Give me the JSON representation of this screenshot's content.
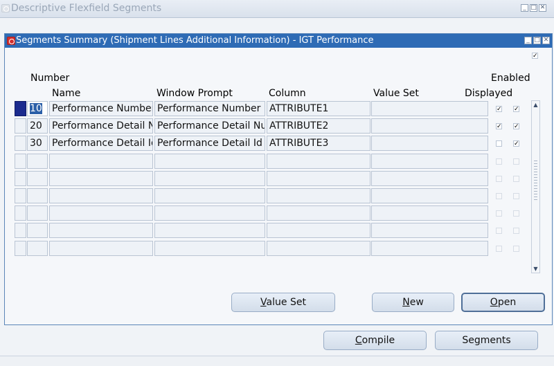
{
  "outer_window": {
    "title": "Descriptive Flexfield Segments",
    "controls": [
      "_",
      "□",
      "✕"
    ]
  },
  "inner_window": {
    "title": "Segments Summary (Shipment Lines Additional Information) - IGT Performance",
    "controls": [
      "_",
      "□",
      "✕"
    ],
    "top_checkbox": "✓"
  },
  "headers": {
    "number": "Number",
    "name": "Name",
    "window_prompt": "Window Prompt",
    "column": "Column",
    "value_set": "Value Set",
    "enabled": "Enabled",
    "displayed": "Displayed"
  },
  "rows": [
    {
      "number": "10",
      "name": "Performance Number",
      "window_prompt": "Performance Number",
      "column": "ATTRIBUTE1",
      "value_set": "",
      "displayed": "✓",
      "enabled": "✓"
    },
    {
      "number": "20",
      "name": "Performance Detail Nu",
      "window_prompt": "Performance Detail Nur",
      "column": "ATTRIBUTE2",
      "value_set": "",
      "displayed": "✓",
      "enabled": "✓"
    },
    {
      "number": "30",
      "name": "Performance Detail Id",
      "window_prompt": "Performance Detail Id",
      "column": "ATTRIBUTE3",
      "value_set": "",
      "displayed": "",
      "enabled": "✓"
    },
    {
      "number": "",
      "name": "",
      "window_prompt": "",
      "column": "",
      "value_set": "",
      "displayed": "",
      "enabled": ""
    },
    {
      "number": "",
      "name": "",
      "window_prompt": "",
      "column": "",
      "value_set": "",
      "displayed": "",
      "enabled": ""
    },
    {
      "number": "",
      "name": "",
      "window_prompt": "",
      "column": "",
      "value_set": "",
      "displayed": "",
      "enabled": ""
    },
    {
      "number": "",
      "name": "",
      "window_prompt": "",
      "column": "",
      "value_set": "",
      "displayed": "",
      "enabled": ""
    },
    {
      "number": "",
      "name": "",
      "window_prompt": "",
      "column": "",
      "value_set": "",
      "displayed": "",
      "enabled": ""
    },
    {
      "number": "",
      "name": "",
      "window_prompt": "",
      "column": "",
      "value_set": "",
      "displayed": "",
      "enabled": ""
    }
  ],
  "scrollbar": {
    "up": "▲",
    "down": "▼"
  },
  "buttons": {
    "value_set": {
      "before": "",
      "mnemonic": "V",
      "after": "alue Set"
    },
    "new": {
      "before": "",
      "mnemonic": "N",
      "after": "ew"
    },
    "open": {
      "before": "",
      "mnemonic": "O",
      "after": "pen"
    },
    "compile": {
      "before": "",
      "mnemonic": "C",
      "after": "ompile"
    },
    "segments": {
      "before": "Se",
      "mnemonic": "g",
      "after": "ments"
    }
  }
}
